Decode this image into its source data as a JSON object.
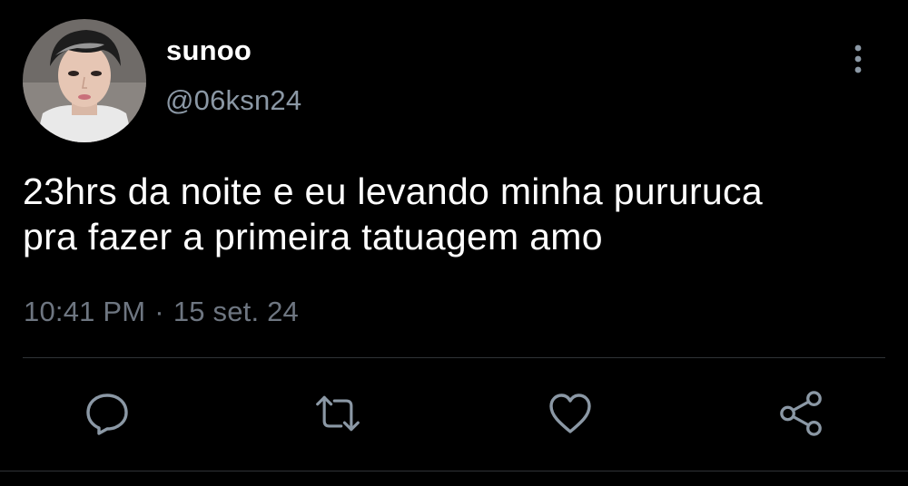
{
  "tweet": {
    "author": {
      "display_name": "sunoo",
      "handle": "@06ksn24",
      "avatar_icon": "profile-photo-avatar"
    },
    "text_lines": [
      "23hrs da noite e eu levando minha pururuca",
      "pra fazer a primeira tatuagem amo"
    ],
    "time": "10:41 PM",
    "separator": "·",
    "date": "15 set. 24"
  },
  "actions": [
    {
      "name": "reply",
      "icon": "comment-icon"
    },
    {
      "name": "retweet",
      "icon": "retweet-icon"
    },
    {
      "name": "like",
      "icon": "heart-icon"
    },
    {
      "name": "share",
      "icon": "share-icon"
    }
  ],
  "menu": {
    "icon": "more-vertical-icon"
  },
  "colors": {
    "background": "#000000",
    "primary_text": "#ffffff",
    "secondary_text": "#8b98a5",
    "icon": "#8b98a5",
    "divider": "#2f3336"
  }
}
